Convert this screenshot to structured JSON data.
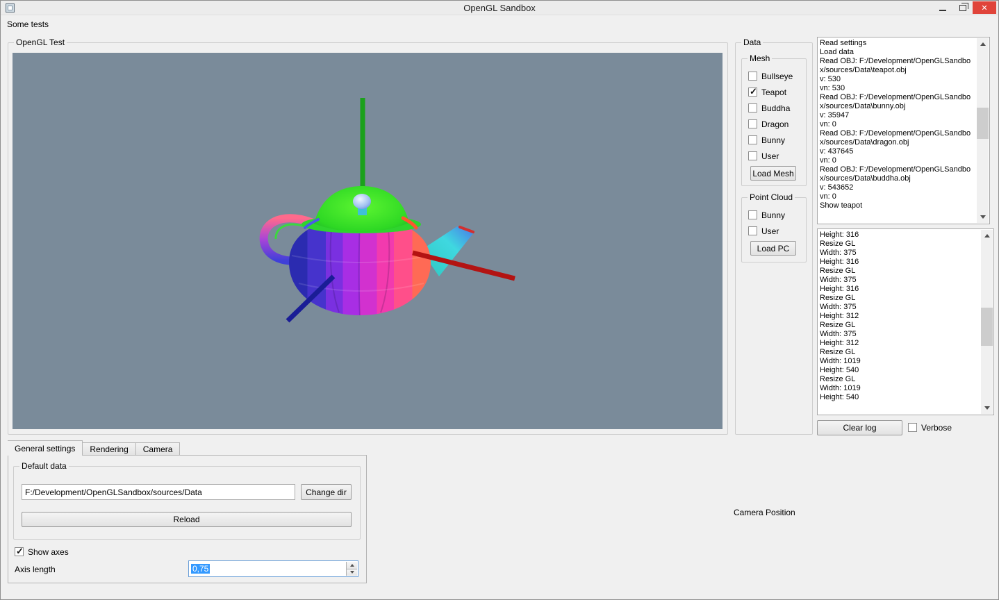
{
  "window": {
    "title": "OpenGL Sandbox",
    "menu_items": [
      {
        "label": "Some tests"
      }
    ]
  },
  "viewport": {
    "group_label": "OpenGL Test"
  },
  "data_panel": {
    "group_label": "Data",
    "mesh_group": {
      "label": "Mesh",
      "items": [
        {
          "label": "Bullseye",
          "checked": false
        },
        {
          "label": "Teapot",
          "checked": true
        },
        {
          "label": "Buddha",
          "checked": false
        },
        {
          "label": "Dragon",
          "checked": false
        },
        {
          "label": "Bunny",
          "checked": false
        },
        {
          "label": "User",
          "checked": false
        }
      ],
      "load_button_label": "Load Mesh"
    },
    "pc_group": {
      "label": "Point Cloud",
      "items": [
        {
          "label": "Bunny",
          "checked": false
        },
        {
          "label": "User",
          "checked": false
        }
      ],
      "load_button_label": "Load PC"
    }
  },
  "log_top": {
    "lines": [
      "Read settings",
      "Load data",
      "Read OBJ: F:/Development/OpenGLSandbox/sources/Data\\teapot.obj",
      "v: 530",
      "vn: 530",
      "Read OBJ: F:/Development/OpenGLSandbox/sources/Data\\bunny.obj",
      "v: 35947",
      "vn: 0",
      "Read OBJ: F:/Development/OpenGLSandbox/sources/Data\\dragon.obj",
      "v: 437645",
      "vn: 0",
      "Read OBJ: F:/Development/OpenGLSandbox/sources/Data\\buddha.obj",
      "v: 543652",
      "vn: 0",
      "Show teapot"
    ]
  },
  "log_bottom": {
    "lines": [
      "Height: 316",
      "Resize GL",
      "Width: 375",
      "Height: 316",
      "Resize GL",
      "Width: 375",
      "Height: 316",
      "Resize GL",
      "Width: 375",
      "Height: 312",
      "Resize GL",
      "Width: 375",
      "Height: 312",
      "Resize GL",
      "Width: 1019",
      "Height: 540",
      "Resize GL",
      "Width: 1019",
      "Height: 540"
    ]
  },
  "log_controls": {
    "clear_button_label": "Clear log",
    "verbose": {
      "label": "Verbose",
      "checked": false
    }
  },
  "settings_panel": {
    "tabs": [
      {
        "label": "General settings",
        "active": true
      },
      {
        "label": "Rendering",
        "active": false
      },
      {
        "label": "Camera",
        "active": false
      }
    ],
    "default_data_group": {
      "label": "Default data",
      "path_value": "F:/Development/OpenGLSandbox/sources/Data",
      "change_dir_label": "Change dir",
      "reload_label": "Reload"
    },
    "show_axes": {
      "label": "Show axes",
      "checked": true
    },
    "axis_length": {
      "label": "Axis length",
      "value": "0,75"
    }
  },
  "camera_position_label": "Camera Position",
  "colors": {
    "viewport_bg": "#7a8b9a",
    "axis_green": "#1ba11b",
    "axis_red": "#b31312",
    "axis_blue": "#1a1d96",
    "selection_bg": "#3399ff",
    "close_button_bg": "#e0443a"
  }
}
